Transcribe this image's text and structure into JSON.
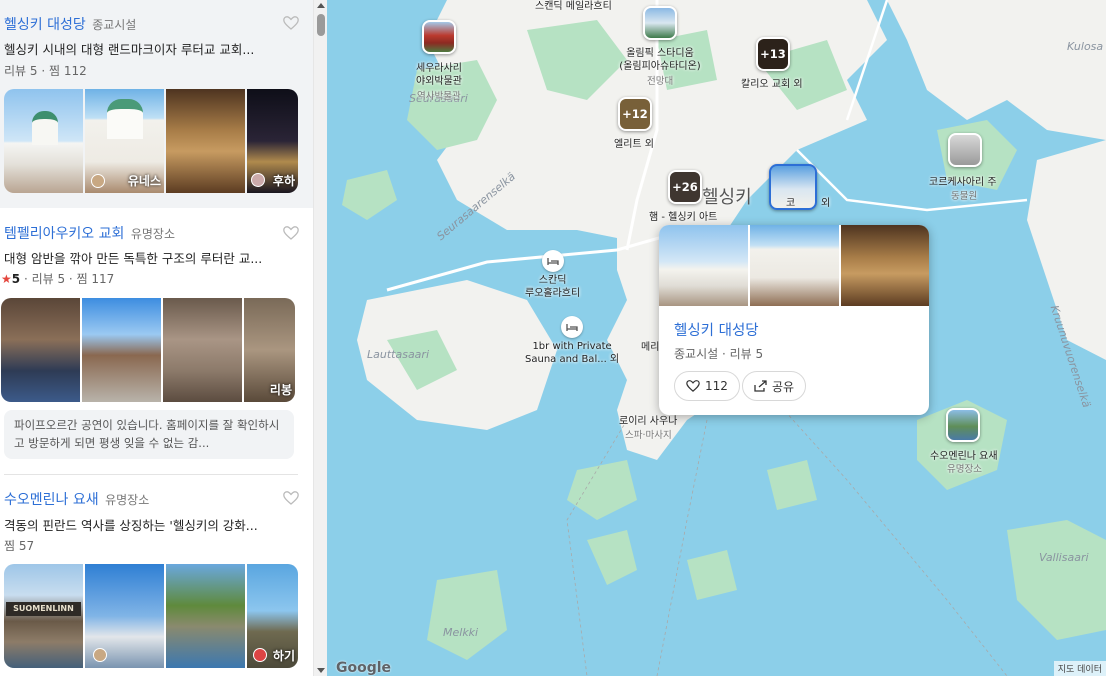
{
  "list": {
    "items": [
      {
        "name": "헬싱키 대성당",
        "category": "종교시설",
        "desc": "헬싱키 시내의 대형 랜드마크이자 루터교 교회...",
        "rating": "",
        "reviews": "리뷰 5",
        "saves": "찜 112",
        "overlay": "유네스",
        "overlay2": "후하",
        "review_text": ""
      },
      {
        "name": "템펠리아우키오 교회",
        "category": "유명장소",
        "desc": "대형 암반을 깎아 만든 독특한 구조의 루터란 교...",
        "rating": "5",
        "reviews": "리뷰 5",
        "saves": "찜 117",
        "overlay": "리봉",
        "review_text": "파이프오르간 공연이 있습니다. 홈페이지를 잘 확인하시고 방문하게 되면 평생 잊을 수 없는 감..."
      },
      {
        "name": "수오멘린나 요새",
        "category": "유명장소",
        "desc": "격동의 핀란드 역사를 상징하는 '헬싱키의 강화...",
        "saves": "찜 57",
        "overlay": "하기",
        "sign": "SUOMENLINN"
      }
    ]
  },
  "map": {
    "markers": [
      {
        "title": "스캔딕 메일라흐티",
        "sub": ""
      },
      {
        "title": "세우라사리\n야외박물관",
        "sub": "역사박물관"
      },
      {
        "title": "올림픽 스타디움\n(올림피아슈타디온)",
        "sub": "전망대"
      },
      {
        "title": "칼리오 교회 외",
        "sub": "",
        "count": "+13"
      },
      {
        "title": "엘리트 외",
        "sub": "",
        "count": "+12"
      },
      {
        "title": "코르케사아리 주",
        "sub": "동물원"
      },
      {
        "title": "햄 - 헬싱키 아트",
        "sub": "",
        "count": "+26"
      },
      {
        "title": "스칸딕\n루오홀라흐티",
        "sub": ""
      },
      {
        "title": "1br with Private\nSauna and Bal... 외",
        "sub": ""
      },
      {
        "title": "로이리 사우나",
        "sub": "스파·마사지"
      },
      {
        "title": "수오멘린나 요새",
        "sub": "유명장소"
      }
    ],
    "partial_labels": [
      "헬싱키",
      "코",
      "외",
      "메리"
    ],
    "place_labels": [
      "Seurasaari",
      "Seurasaarenselkä",
      "Lauttasaari",
      "Melkki",
      "Vallisaari",
      "Kulosa",
      "Kruunuvuorenselkä"
    ],
    "popup": {
      "title": "헬싱키 대성당",
      "meta": "종교시설 · 리뷰 5",
      "likes": "112",
      "share": "공유"
    },
    "google": "Google",
    "data_credit": "지도 데이터"
  },
  "colors": {
    "accent": "#2d6fd6",
    "water": "#8ccfe9",
    "park": "#b6e2c3",
    "land": "#f2f2ef"
  }
}
